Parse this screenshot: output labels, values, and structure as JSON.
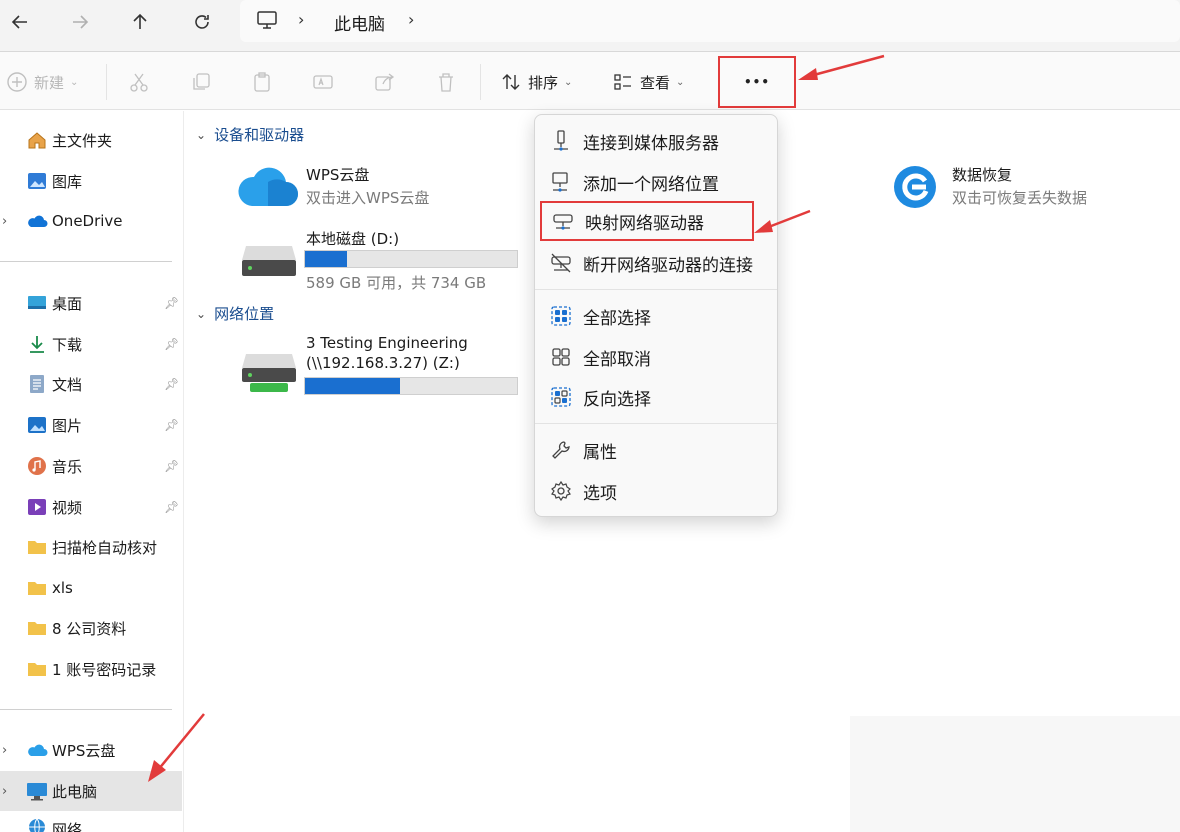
{
  "address": {
    "crumb": "此电脑"
  },
  "toolbar": {
    "new_label": "新建",
    "sort_label": "排序",
    "view_label": "查看",
    "more_label": "•••"
  },
  "sidebar": {
    "items": [
      {
        "label": "主文件夹",
        "icon": "home-icon"
      },
      {
        "label": "图库",
        "icon": "gallery-icon"
      },
      {
        "label": "OneDrive",
        "icon": "onedrive-icon"
      },
      {
        "label": "桌面",
        "icon": "desktop-icon"
      },
      {
        "label": "下载",
        "icon": "download-icon"
      },
      {
        "label": "文档",
        "icon": "document-icon"
      },
      {
        "label": "图片",
        "icon": "pictures-icon"
      },
      {
        "label": "音乐",
        "icon": "music-icon"
      },
      {
        "label": "视频",
        "icon": "video-icon"
      },
      {
        "label": "扫描枪自动核对",
        "icon": "folder-icon"
      },
      {
        "label": "xls",
        "icon": "folder-icon"
      },
      {
        "label": "8 公司资料",
        "icon": "folder-icon"
      },
      {
        "label": "1 账号密码记录",
        "icon": "folder-icon"
      },
      {
        "label": "WPS云盘",
        "icon": "wps-cloud-icon"
      },
      {
        "label": "此电脑",
        "icon": "computer-icon"
      },
      {
        "label": "网络",
        "icon": "network-icon"
      }
    ]
  },
  "content": {
    "section_devices": "设备和驱动器",
    "section_network": "网络位置",
    "wps": {
      "title": "WPS云盘",
      "sub": "双击进入WPS云盘"
    },
    "local_disk": {
      "title": "本地磁盘 (D:)",
      "sub": "589 GB 可用，共 734 GB",
      "used_fraction": 0.2
    },
    "net_drive": {
      "title_line1": "3 Testing Engineering",
      "title_line2": "(\\\\192.168.3.27) (Z:)",
      "used_fraction": 0.45
    },
    "recovery": {
      "title": "数据恢复",
      "sub": "双击可恢复丢失数据"
    }
  },
  "menu": {
    "items": [
      {
        "label": "连接到媒体服务器",
        "icon": "media-server-icon"
      },
      {
        "label": "添加一个网络位置",
        "icon": "network-location-icon"
      },
      {
        "label": "映射网络驱动器",
        "icon": "map-drive-icon"
      },
      {
        "label": "断开网络驱动器的连接",
        "icon": "disconnect-drive-icon"
      },
      {
        "label": "全部选择",
        "icon": "select-all-icon"
      },
      {
        "label": "全部取消",
        "icon": "select-none-icon"
      },
      {
        "label": "反向选择",
        "icon": "invert-selection-icon"
      },
      {
        "label": "属性",
        "icon": "properties-icon"
      },
      {
        "label": "选项",
        "icon": "options-icon"
      }
    ]
  },
  "colors": {
    "accent": "#1a6fd0",
    "highlight": "#e23b3b"
  }
}
